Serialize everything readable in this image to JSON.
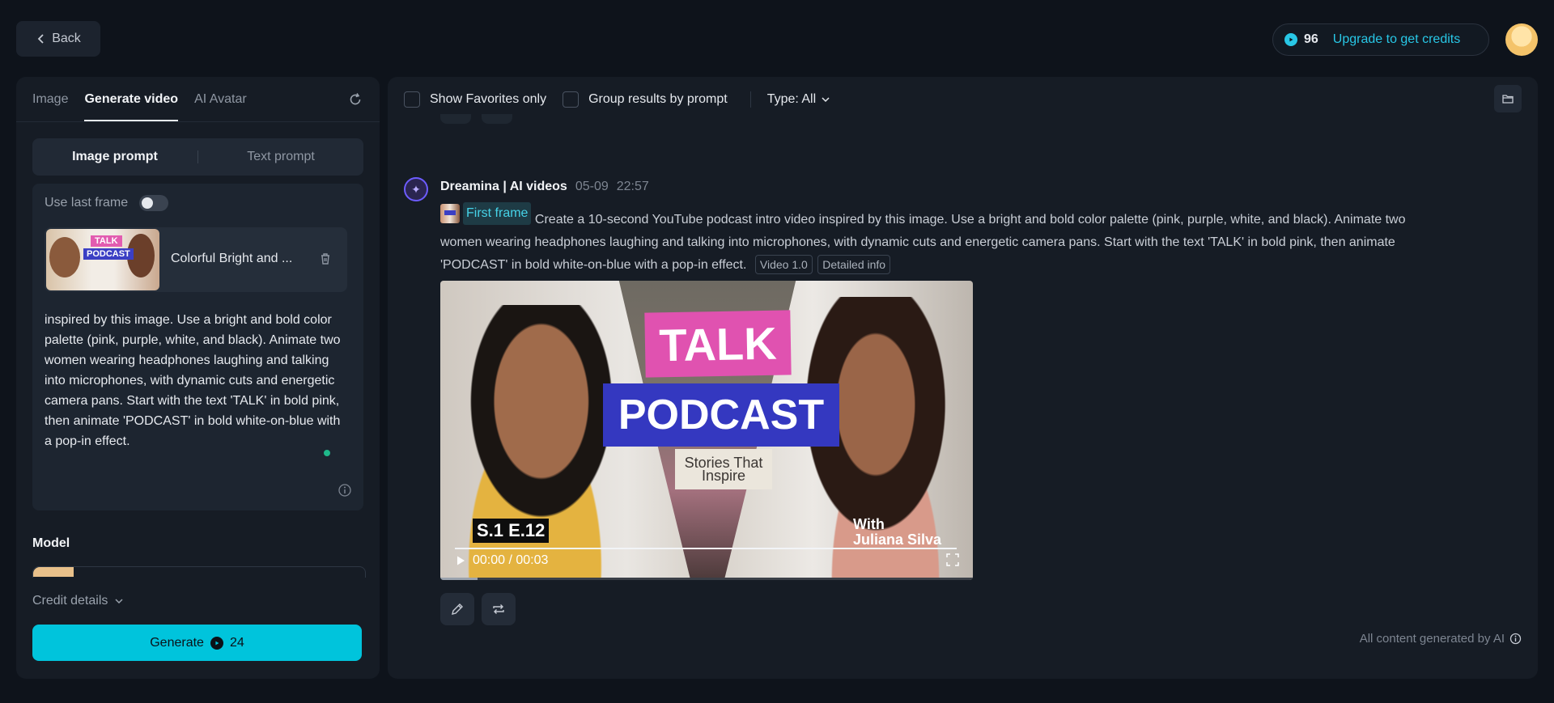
{
  "header": {
    "back_label": "Back",
    "credits": "96",
    "upgrade_label": "Upgrade to get credits"
  },
  "left_panel": {
    "tabs": [
      {
        "label": "Image"
      },
      {
        "label": "Generate video"
      },
      {
        "label": "AI Avatar"
      }
    ],
    "prompt_modes": {
      "image": "Image prompt",
      "text": "Text prompt"
    },
    "use_last_frame_label": "Use last frame",
    "frame": {
      "name": "Colorful Bright and ...",
      "thumb_text_1": "TALK",
      "thumb_text_2": "PODCAST"
    },
    "prompt_text": "inspired by this image. Use a bright and bold color palette (pink, purple, white, and black). Animate two women wearing headphones laughing and talking into microphones, with dynamic cuts and energetic camera pans. Start with the text 'TALK' in bold pink, then animate 'PODCAST' in bold white-on-blue with a pop-in effect.",
    "model_label": "Model",
    "credit_details_label": "Credit details",
    "generate": {
      "label": "Generate",
      "cost": "24"
    }
  },
  "right_panel": {
    "filters": {
      "favorites_label": "Show Favorites only",
      "group_label": "Group results by prompt",
      "type_label": "Type: All"
    },
    "message": {
      "author": "Dreamina | AI videos",
      "date": "05-09",
      "time": "22:57",
      "first_frame_label": "First frame",
      "prompt": "Create a 10-second YouTube podcast intro video inspired by this image. Use a bright and bold color palette (pink, purple, white, and black). Animate two women wearing headphones laughing and talking into microphones, with dynamic cuts and energetic camera pans. Start with the text 'TALK' in bold pink, then animate 'PODCAST' in bold white-on-blue with a pop-in effect.",
      "tag_model": "Video 1.0",
      "tag_info": "Detailed info"
    },
    "video": {
      "title_top": "TALK",
      "title_main": "PODCAST",
      "subtitle": "Stories That Inspire",
      "episode": "S.1 E.12",
      "with_line1": "With",
      "with_line2": "Juliana Silva",
      "time_display": "00:00 / 00:03"
    },
    "footer_note": "All content generated by AI"
  },
  "colors": {
    "accent": "#00c4dc",
    "background": "#0e131b",
    "panel": "#161c25",
    "pink": "#e052b0",
    "blue": "#3438c0"
  }
}
